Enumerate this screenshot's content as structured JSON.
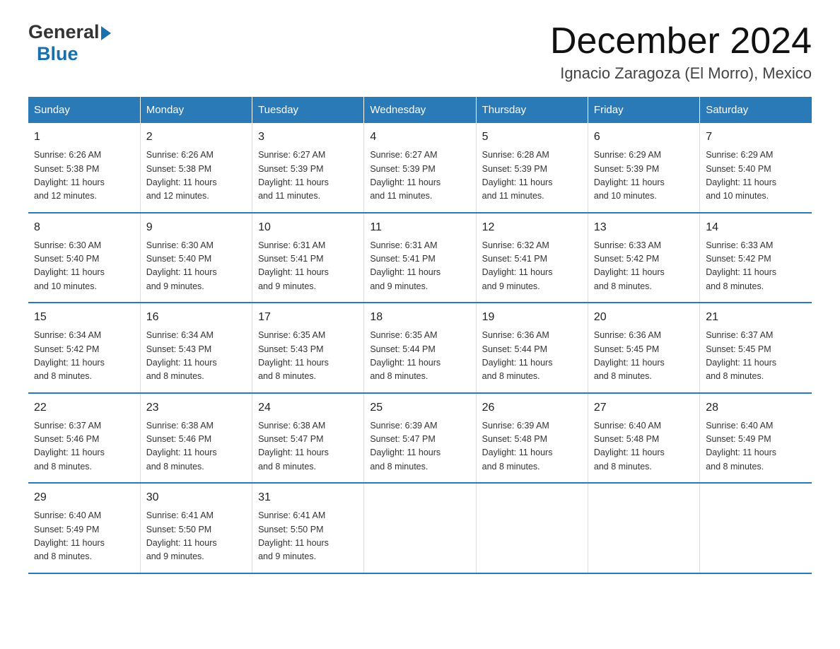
{
  "header": {
    "logo_general": "General",
    "logo_blue": "Blue",
    "month_title": "December 2024",
    "location": "Ignacio Zaragoza (El Morro), Mexico"
  },
  "days_of_week": [
    "Sunday",
    "Monday",
    "Tuesday",
    "Wednesday",
    "Thursday",
    "Friday",
    "Saturday"
  ],
  "weeks": [
    [
      {
        "day": "1",
        "sunrise": "6:26 AM",
        "sunset": "5:38 PM",
        "daylight": "11 hours and 12 minutes."
      },
      {
        "day": "2",
        "sunrise": "6:26 AM",
        "sunset": "5:38 PM",
        "daylight": "11 hours and 12 minutes."
      },
      {
        "day": "3",
        "sunrise": "6:27 AM",
        "sunset": "5:39 PM",
        "daylight": "11 hours and 11 minutes."
      },
      {
        "day": "4",
        "sunrise": "6:27 AM",
        "sunset": "5:39 PM",
        "daylight": "11 hours and 11 minutes."
      },
      {
        "day": "5",
        "sunrise": "6:28 AM",
        "sunset": "5:39 PM",
        "daylight": "11 hours and 11 minutes."
      },
      {
        "day": "6",
        "sunrise": "6:29 AM",
        "sunset": "5:39 PM",
        "daylight": "11 hours and 10 minutes."
      },
      {
        "day": "7",
        "sunrise": "6:29 AM",
        "sunset": "5:40 PM",
        "daylight": "11 hours and 10 minutes."
      }
    ],
    [
      {
        "day": "8",
        "sunrise": "6:30 AM",
        "sunset": "5:40 PM",
        "daylight": "11 hours and 10 minutes."
      },
      {
        "day": "9",
        "sunrise": "6:30 AM",
        "sunset": "5:40 PM",
        "daylight": "11 hours and 9 minutes."
      },
      {
        "day": "10",
        "sunrise": "6:31 AM",
        "sunset": "5:41 PM",
        "daylight": "11 hours and 9 minutes."
      },
      {
        "day": "11",
        "sunrise": "6:31 AM",
        "sunset": "5:41 PM",
        "daylight": "11 hours and 9 minutes."
      },
      {
        "day": "12",
        "sunrise": "6:32 AM",
        "sunset": "5:41 PM",
        "daylight": "11 hours and 9 minutes."
      },
      {
        "day": "13",
        "sunrise": "6:33 AM",
        "sunset": "5:42 PM",
        "daylight": "11 hours and 8 minutes."
      },
      {
        "day": "14",
        "sunrise": "6:33 AM",
        "sunset": "5:42 PM",
        "daylight": "11 hours and 8 minutes."
      }
    ],
    [
      {
        "day": "15",
        "sunrise": "6:34 AM",
        "sunset": "5:42 PM",
        "daylight": "11 hours and 8 minutes."
      },
      {
        "day": "16",
        "sunrise": "6:34 AM",
        "sunset": "5:43 PM",
        "daylight": "11 hours and 8 minutes."
      },
      {
        "day": "17",
        "sunrise": "6:35 AM",
        "sunset": "5:43 PM",
        "daylight": "11 hours and 8 minutes."
      },
      {
        "day": "18",
        "sunrise": "6:35 AM",
        "sunset": "5:44 PM",
        "daylight": "11 hours and 8 minutes."
      },
      {
        "day": "19",
        "sunrise": "6:36 AM",
        "sunset": "5:44 PM",
        "daylight": "11 hours and 8 minutes."
      },
      {
        "day": "20",
        "sunrise": "6:36 AM",
        "sunset": "5:45 PM",
        "daylight": "11 hours and 8 minutes."
      },
      {
        "day": "21",
        "sunrise": "6:37 AM",
        "sunset": "5:45 PM",
        "daylight": "11 hours and 8 minutes."
      }
    ],
    [
      {
        "day": "22",
        "sunrise": "6:37 AM",
        "sunset": "5:46 PM",
        "daylight": "11 hours and 8 minutes."
      },
      {
        "day": "23",
        "sunrise": "6:38 AM",
        "sunset": "5:46 PM",
        "daylight": "11 hours and 8 minutes."
      },
      {
        "day": "24",
        "sunrise": "6:38 AM",
        "sunset": "5:47 PM",
        "daylight": "11 hours and 8 minutes."
      },
      {
        "day": "25",
        "sunrise": "6:39 AM",
        "sunset": "5:47 PM",
        "daylight": "11 hours and 8 minutes."
      },
      {
        "day": "26",
        "sunrise": "6:39 AM",
        "sunset": "5:48 PM",
        "daylight": "11 hours and 8 minutes."
      },
      {
        "day": "27",
        "sunrise": "6:40 AM",
        "sunset": "5:48 PM",
        "daylight": "11 hours and 8 minutes."
      },
      {
        "day": "28",
        "sunrise": "6:40 AM",
        "sunset": "5:49 PM",
        "daylight": "11 hours and 8 minutes."
      }
    ],
    [
      {
        "day": "29",
        "sunrise": "6:40 AM",
        "sunset": "5:49 PM",
        "daylight": "11 hours and 8 minutes."
      },
      {
        "day": "30",
        "sunrise": "6:41 AM",
        "sunset": "5:50 PM",
        "daylight": "11 hours and 9 minutes."
      },
      {
        "day": "31",
        "sunrise": "6:41 AM",
        "sunset": "5:50 PM",
        "daylight": "11 hours and 9 minutes."
      },
      null,
      null,
      null,
      null
    ]
  ],
  "labels": {
    "sunrise": "Sunrise:",
    "sunset": "Sunset:",
    "daylight": "Daylight:"
  }
}
